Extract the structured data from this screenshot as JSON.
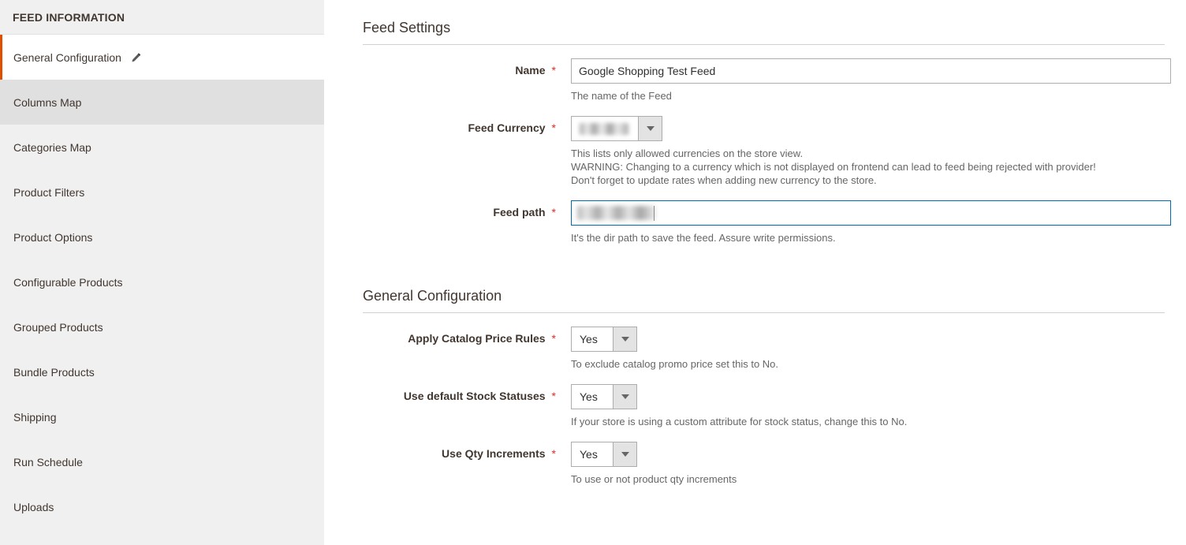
{
  "sidebar": {
    "header": "FEED INFORMATION",
    "items": [
      {
        "label": "General Configuration",
        "state": "active",
        "icon": "pencil-icon"
      },
      {
        "label": "Columns Map",
        "state": "hovered"
      },
      {
        "label": "Categories Map",
        "state": "default"
      },
      {
        "label": "Product Filters",
        "state": "default"
      },
      {
        "label": "Product Options",
        "state": "default"
      },
      {
        "label": "Configurable Products",
        "state": "default"
      },
      {
        "label": "Grouped Products",
        "state": "default"
      },
      {
        "label": "Bundle Products",
        "state": "default"
      },
      {
        "label": "Shipping",
        "state": "default"
      },
      {
        "label": "Run Schedule",
        "state": "default"
      },
      {
        "label": "Uploads",
        "state": "default"
      }
    ]
  },
  "feed_settings": {
    "title": "Feed Settings",
    "name": {
      "label": "Name",
      "required": "*",
      "value": "Google Shopping Test Feed",
      "note": "The name of the Feed"
    },
    "feed_currency": {
      "label": "Feed Currency",
      "required": "*",
      "value": "",
      "note_line_1": "This lists only allowed currencies on the store view.",
      "note_line_2": "WARNING: Changing to a currency which is not displayed on frontend can lead to feed being rejected with provider!",
      "note_line_3": "Don't forget to update rates when adding new currency to the store."
    },
    "feed_path": {
      "label": "Feed path",
      "required": "*",
      "value": "",
      "note": "It's the dir path to save the feed. Assure write permissions."
    }
  },
  "general_configuration": {
    "title": "General Configuration",
    "fields": [
      {
        "label": "Apply Catalog Price Rules",
        "required": "*",
        "value": "Yes",
        "note": "To exclude catalog promo price set this to No."
      },
      {
        "label": "Use default Stock Statuses",
        "required": "*",
        "value": "Yes",
        "note": "If your store is using a custom attribute for stock status, change this to No."
      },
      {
        "label": "Use Qty Increments",
        "required": "*",
        "value": "Yes",
        "note": "To use or not product qty increments"
      }
    ]
  },
  "colors": {
    "accent_orange": "#e04f00",
    "focus_blue": "#006bb4",
    "required_red": "#e02b27",
    "sidebar_bg": "#f0f0f0",
    "sidebar_hover": "#e0e0e0",
    "text": "#41362f",
    "note_text": "#666666"
  }
}
